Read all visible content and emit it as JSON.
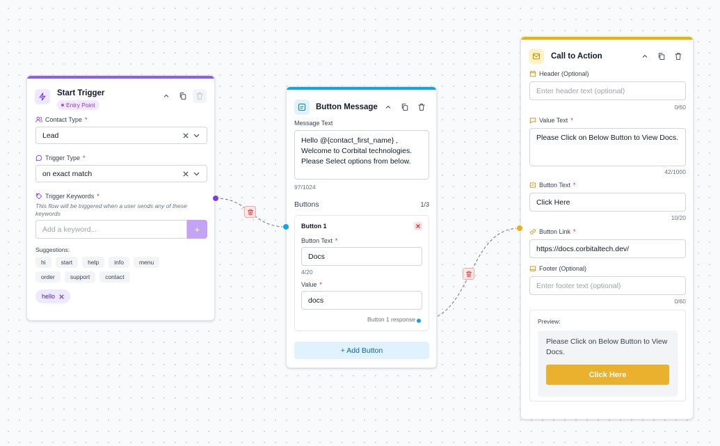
{
  "start_trigger": {
    "title": "Start Trigger",
    "badge": "Entry Point",
    "contact_type": {
      "label": "Contact Type",
      "value": "Lead"
    },
    "trigger_type": {
      "label": "Trigger Type",
      "value": "on exact match"
    },
    "trigger_keywords": {
      "label": "Trigger Keywords",
      "hint": "This flow will be triggered when a user sends any of these keywords",
      "placeholder": "Add a keyword...",
      "add_label": "+"
    },
    "suggestions_label": "Suggestions:",
    "suggestions": [
      "hi",
      "start",
      "help",
      "info",
      "menu",
      "order",
      "support",
      "contact"
    ],
    "selected_keywords": [
      "hello"
    ]
  },
  "button_message": {
    "title": "Button Message",
    "message_label": "Message Text",
    "message_lines": [
      "Hello @{contact_first_name} ,",
      "Welcome to Corbital technologies.",
      "Please Select options from below."
    ],
    "message_counter": "97/1024",
    "buttons_label": "Buttons",
    "buttons_count": "1/3",
    "button1": {
      "title": "Button 1",
      "text_label": "Button Text",
      "text_value": "Docs",
      "text_counter": "4/20",
      "value_label": "Value",
      "value_value": "docs",
      "response_label": "Button 1 response"
    },
    "add_button_label": "+ Add Button"
  },
  "cta": {
    "title": "Call to Action",
    "header_label": "Header (Optional)",
    "header_placeholder": "Enter header text (optional)",
    "header_counter": "0/60",
    "value_label": "Value Text",
    "value_text": "Please Click on Below Button to View Docs.",
    "value_counter": "42/1000",
    "button_text_label": "Button Text",
    "button_text_value": "Click Here",
    "button_text_counter": "10/20",
    "button_link_label": "Button Link",
    "button_link_value": "https://docs.corbitaltech.dev/",
    "footer_label": "Footer (Optional)",
    "footer_placeholder": "Enter footer text (optional)",
    "footer_counter": "0/60",
    "preview_label": "Preview:",
    "preview_text": "Please Click on Below Button to View Docs.",
    "preview_button": "Click Here"
  },
  "colors": {
    "start_accent": "#8b5cf6",
    "button_message_accent": "#0ea5e9",
    "cta_accent": "#eab308",
    "preview_button": "#e9b12e"
  }
}
